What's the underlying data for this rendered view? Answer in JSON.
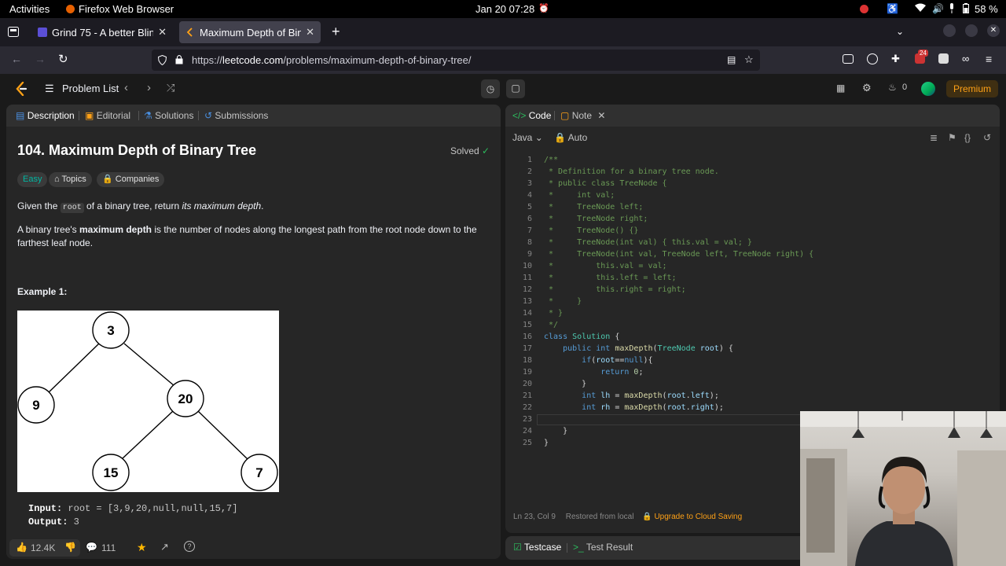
{
  "system": {
    "activities": "Activities",
    "app_name": "Firefox Web Browser",
    "datetime": "Jan 20  07:28",
    "battery": "58 %"
  },
  "browser": {
    "tabs": [
      {
        "label": "Grind 75 - A better Blind",
        "active": false
      },
      {
        "label": "Maximum Depth of Binar",
        "active": true
      }
    ],
    "url_prefix": "https://",
    "url_domain": "leetcode.com",
    "url_path": "/problems/maximum-depth-of-binary-tree/",
    "ext_badge": "24"
  },
  "lc_header": {
    "problem_list": "Problem List",
    "streak": "0",
    "premium": "Premium"
  },
  "left_panel": {
    "tabs": [
      "Description",
      "Editorial",
      "Solutions",
      "Submissions"
    ],
    "title": "104. Maximum Depth of Binary Tree",
    "solved": "Solved",
    "difficulty": "Easy",
    "topics": "Topics",
    "companies": "Companies",
    "p1_pre": "Given the ",
    "p1_code": "root",
    "p1_mid": " of a binary tree, return ",
    "p1_em": "its maximum depth",
    "p1_end": ".",
    "p2_pre": "A binary tree's ",
    "p2_bold": "maximum depth",
    "p2_rest": " is the number of nodes along the longest path from the root node down to the farthest leaf node.",
    "example_heading": "Example 1:",
    "tree_nodes": [
      "3",
      "9",
      "20",
      "15",
      "7"
    ],
    "input_label": "Input:",
    "input_value": "root = [3,9,20,null,null,15,7]",
    "output_label": "Output:",
    "output_value": "3",
    "likes": "12.4K",
    "comments": "111"
  },
  "right_panel": {
    "code_tab": "Code",
    "note_tab": "Note",
    "language": "Java",
    "auto": "Auto",
    "cursor_pos": "Ln 23, Col 9",
    "restored": "Restored from local",
    "upgrade": "Upgrade to Cloud Saving",
    "testcase_tab": "Testcase",
    "result_tab": "Test Result"
  },
  "code_lines": [
    "/**",
    " * Definition for a binary tree node.",
    " * public class TreeNode {",
    " *     int val;",
    " *     TreeNode left;",
    " *     TreeNode right;",
    " *     TreeNode() {}",
    " *     TreeNode(int val) { this.val = val; }",
    " *     TreeNode(int val, TreeNode left, TreeNode right) {",
    " *         this.val = val;",
    " *         this.left = left;",
    " *         this.right = right;",
    " *     }",
    " * }",
    " */",
    "class Solution {",
    "    public int maxDepth(TreeNode root) {",
    "        if(root==null){",
    "            return 0;",
    "        }",
    "        int lh = maxDepth(root.left);",
    "        int rh = maxDepth(root.right);",
    "",
    "    }",
    "}"
  ],
  "colors": {
    "accent": "#ffa116",
    "easy": "#00b8a3",
    "solved": "#2cbb5d"
  }
}
